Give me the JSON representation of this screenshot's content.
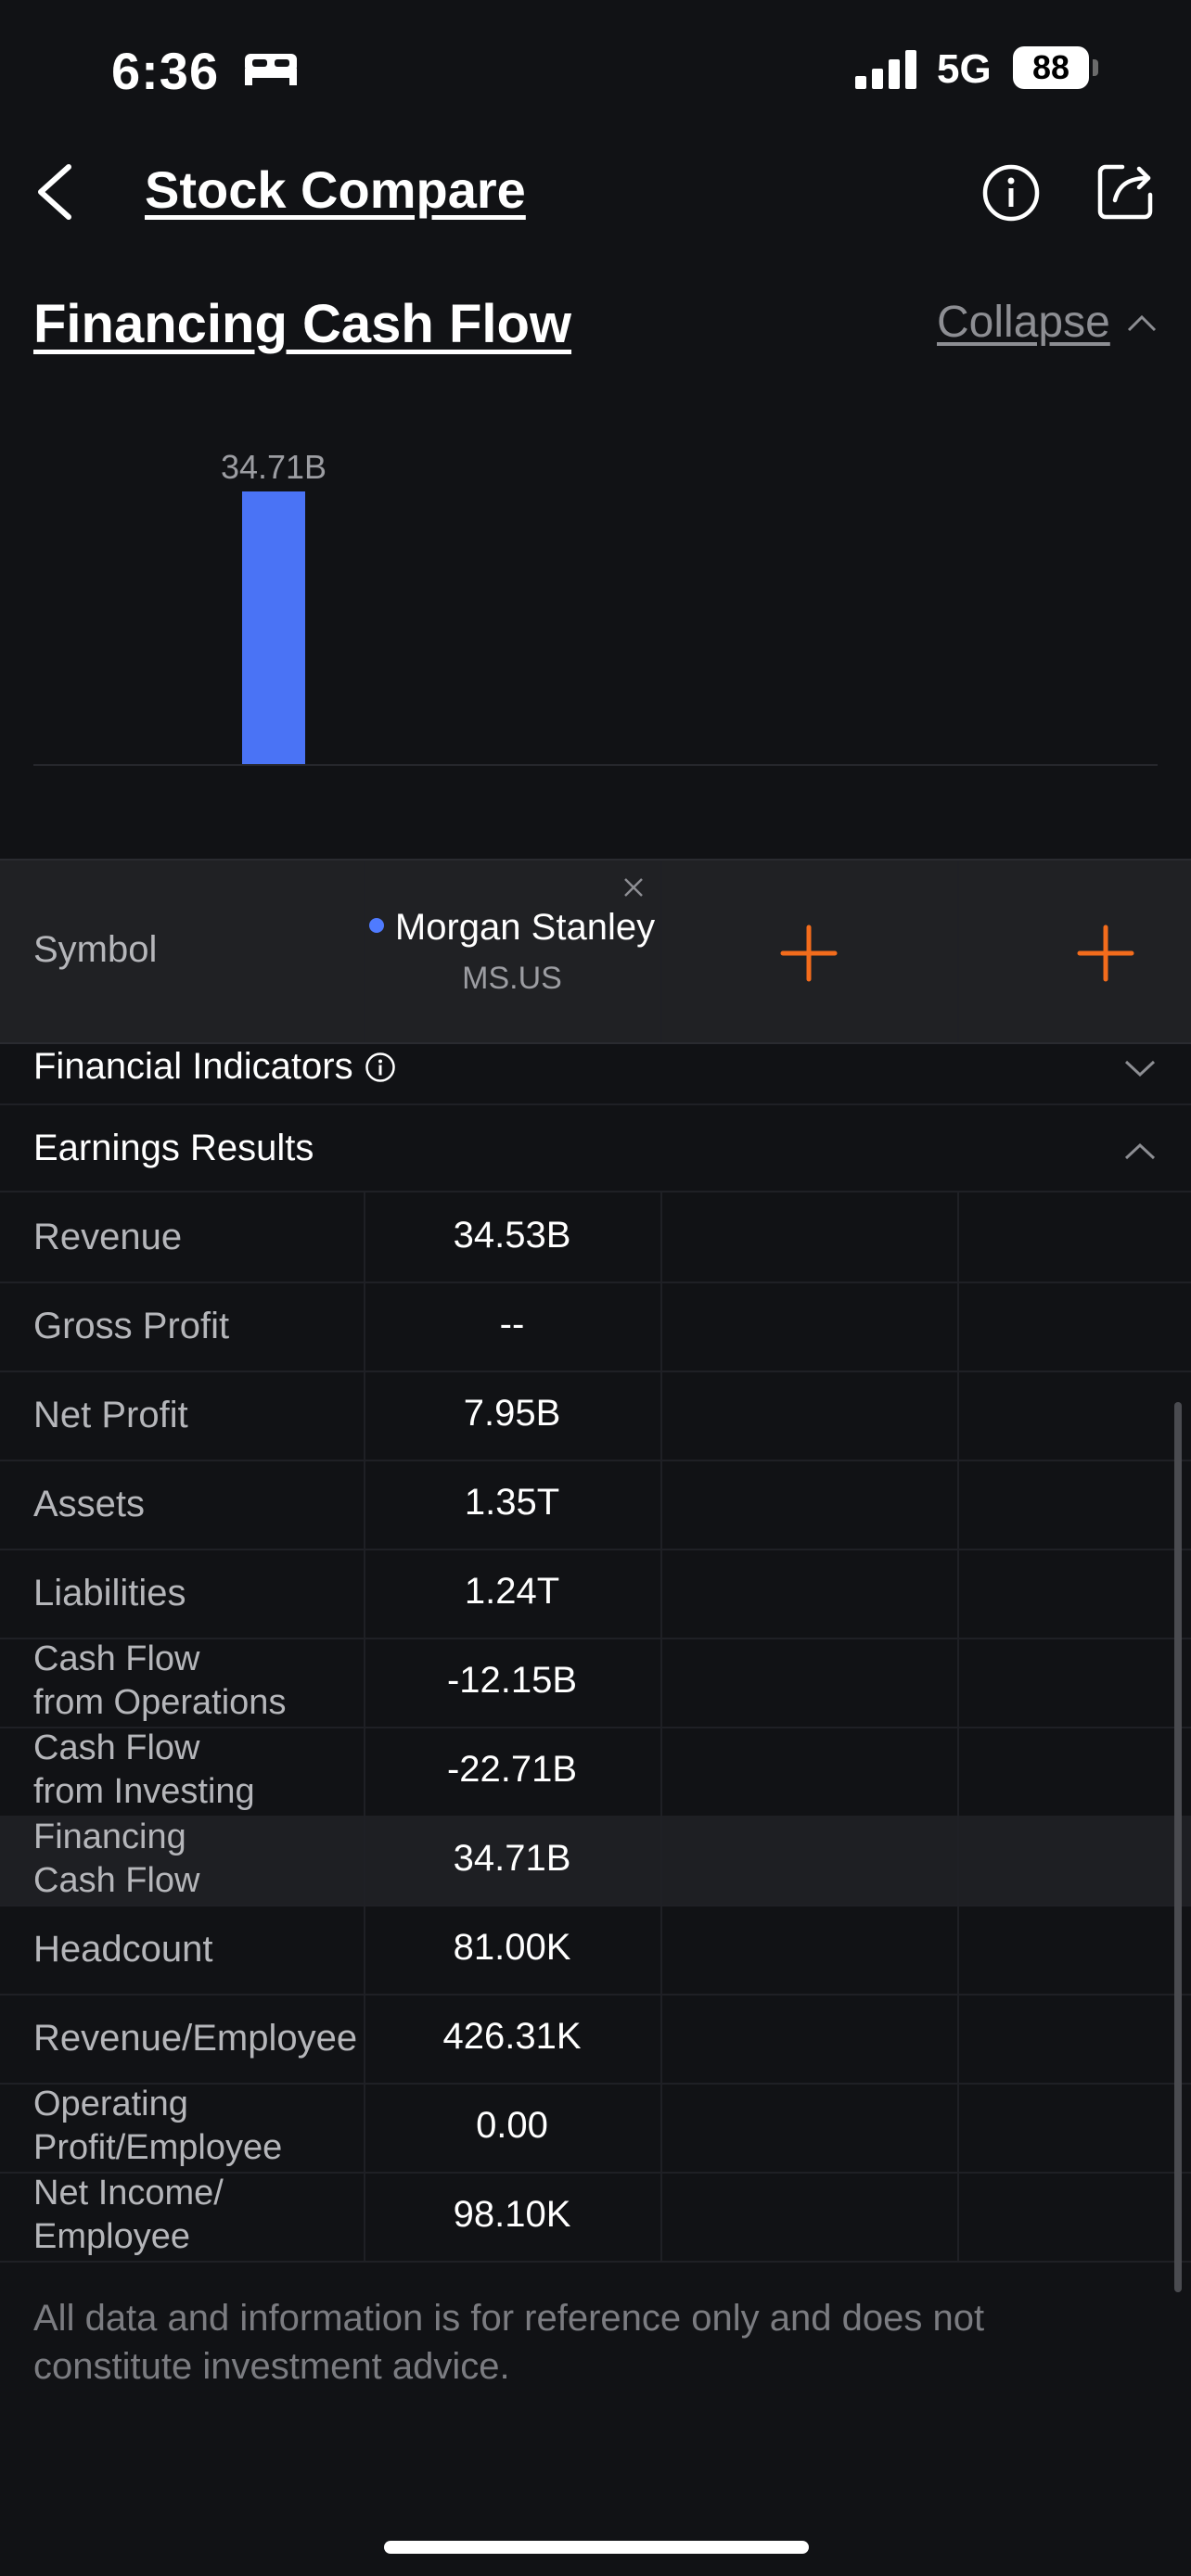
{
  "status_bar": {
    "time": "6:36",
    "network": "5G",
    "battery": "88"
  },
  "nav": {
    "title": "Stock Compare"
  },
  "section": {
    "title": "Financing Cash Flow",
    "collapse_label": "Collapse"
  },
  "chart_data": {
    "type": "bar",
    "series": [
      {
        "name": "Morgan Stanley",
        "values": [
          34.71
        ]
      }
    ],
    "data_labels": [
      "34.71B"
    ],
    "bar_color": "#4a73f5"
  },
  "table": {
    "symbol_label": "Symbol",
    "stock": {
      "name": "Morgan Stanley",
      "ticker": "MS.US"
    },
    "financial_indicators_label": "Financial Indicators",
    "earnings_results_label": "Earnings Results",
    "rows": [
      {
        "label": "Revenue",
        "value": "34.53B"
      },
      {
        "label": "Gross Profit",
        "value": "--"
      },
      {
        "label": "Net Profit",
        "value": "7.95B"
      },
      {
        "label": "Assets",
        "value": "1.35T"
      },
      {
        "label": "Liabilities",
        "value": "1.24T"
      },
      {
        "label": "Cash Flow\nfrom Operations",
        "value": "-12.15B"
      },
      {
        "label": "Cash Flow\nfrom Investing",
        "value": "-22.71B"
      },
      {
        "label": "Financing\nCash Flow",
        "value": "34.71B",
        "highlighted": true
      },
      {
        "label": "Headcount",
        "value": "81.00K"
      },
      {
        "label": "Revenue/Employee",
        "value": "426.31K"
      },
      {
        "label": "Operating\nProfit/Employee",
        "value": "0.00"
      },
      {
        "label": "Net Income/\nEmployee",
        "value": "98.10K"
      }
    ]
  },
  "disclaimer": "All data and information is for reference only and does not constitute investment advice.",
  "colors": {
    "background": "#111215",
    "accent": "#f36c1c",
    "series": "#4a73f5"
  }
}
